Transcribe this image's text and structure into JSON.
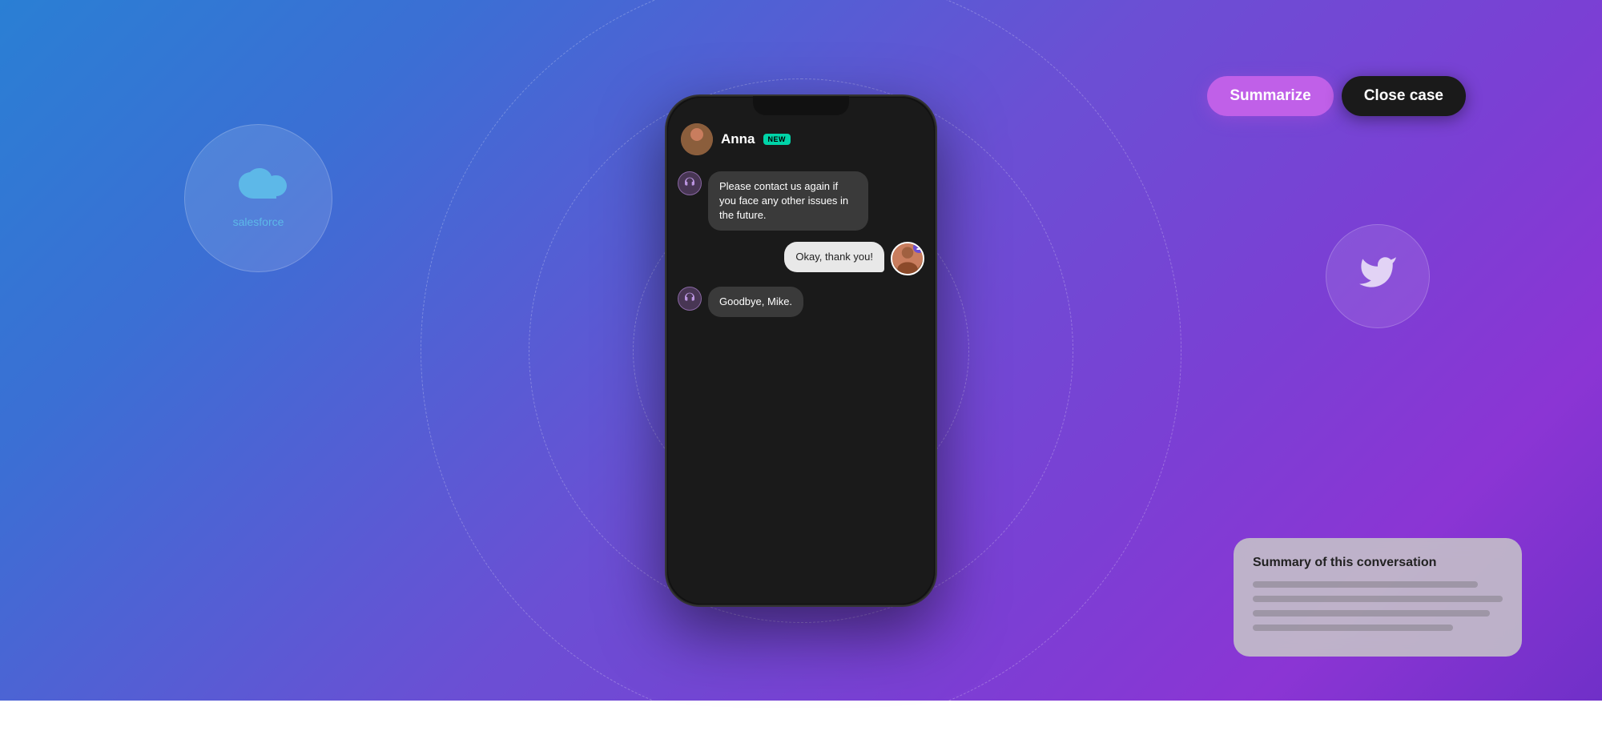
{
  "background": {
    "gradient_start": "#2a7fd4",
    "gradient_end": "#7030c8"
  },
  "phone": {
    "header": {
      "user_name": "Anna",
      "badge": "NEW"
    },
    "messages": [
      {
        "type": "agent",
        "text": "Please contact us again if you face any other issues in the future.",
        "icon": "🎧"
      },
      {
        "type": "user",
        "text": "Okay, thank you!"
      },
      {
        "type": "agent",
        "text": "Goodbye, Mike.",
        "icon": "🎧"
      }
    ]
  },
  "buttons": {
    "summarize": "Summarize",
    "close_case": "Close case"
  },
  "summary_card": {
    "title": "Summary of this conversation"
  },
  "salesforce": {
    "text": "salesforce"
  },
  "integrations": {
    "salesforce_label": "salesforce",
    "bird_label": "bird"
  }
}
